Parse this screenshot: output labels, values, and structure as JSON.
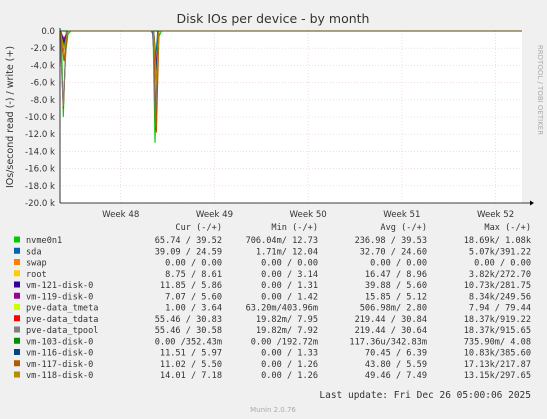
{
  "chart_data": {
    "type": "line",
    "title": "Disk IOs per device - by month",
    "ylabel": "IOs/second read (-) / write (+)",
    "xlabel": "",
    "ylim": [
      -20000,
      0
    ],
    "y_ticks": [
      "0.0",
      "-2.0 k",
      "-4.0 k",
      "-6.0 k",
      "-8.0 k",
      "-10.0 k",
      "-12.0 k",
      "-14.0 k",
      "-16.0 k",
      "-18.0 k",
      "-20.0 k"
    ],
    "y_tick_values": [
      0,
      -2000,
      -4000,
      -6000,
      -8000,
      -10000,
      -12000,
      -14000,
      -16000,
      -18000,
      -20000
    ],
    "x_ticks": [
      "Week 48",
      "Week 49",
      "Week 50",
      "Week 51",
      "Week 52"
    ],
    "x_range": [
      0,
      35
    ],
    "x_tick_values": [
      4.6,
      11.7,
      18.8,
      25.9,
      33.0
    ],
    "grid": true,
    "side_label": "RRDTOOL / TOBI OETIKER",
    "columns": [
      "Cur (-/+)",
      "Min (-/+)",
      "Avg (-/+)",
      "Max (-/+)"
    ],
    "series": [
      {
        "name": "nvme0n1",
        "color": "#00cc00",
        "cur": "65.74 / 39.52",
        "min": "706.04m/ 12.73",
        "avg": "236.98 / 39.53",
        "max": "18.69k/  1.08k",
        "x": [
          0,
          0.1,
          0.25,
          0.4,
          0.6,
          0.8,
          6.9,
          7.05,
          7.2,
          7.35,
          7.5,
          7.7,
          35
        ],
        "y": [
          0,
          -150,
          -10000,
          -2800,
          -400,
          0,
          0,
          -400,
          -13000,
          -5000,
          -600,
          0,
          0
        ]
      },
      {
        "name": "sda",
        "color": "#0066b3",
        "cur": "39.09 / 24.59",
        "min": "1.71m/ 12.04",
        "avg": "32.70 / 24.60",
        "max": "5.07k/391.22",
        "x": [
          0,
          0.25,
          0.5,
          7.0,
          7.2,
          7.4,
          35
        ],
        "y": [
          0,
          -2500,
          0,
          0,
          -4500,
          0,
          0
        ]
      },
      {
        "name": "swap",
        "color": "#ff8000",
        "cur": "0.00 /  0.00",
        "min": "0.00 /  0.00",
        "avg": "0.00 /  0.00",
        "max": "0.00 /  0.00",
        "x": [
          0,
          35
        ],
        "y": [
          0,
          0
        ]
      },
      {
        "name": "root",
        "color": "#ffcc00",
        "cur": "8.75 /  8.61",
        "min": "0.00 /  3.14",
        "avg": "16.47 /  8.96",
        "max": "3.82k/272.70",
        "x": [
          0,
          0.3,
          0.6,
          7.1,
          7.3,
          7.5,
          35
        ],
        "y": [
          0,
          -3000,
          0,
          0,
          -3800,
          0,
          0
        ]
      },
      {
        "name": "vm-121-disk-0",
        "color": "#330099",
        "cur": "11.85 /  5.86",
        "min": "0.00 /  1.31",
        "avg": "39.88 /  5.60",
        "max": "10.73k/281.75",
        "x": [
          0,
          0.3,
          0.6,
          7.1,
          7.3,
          7.5,
          35
        ],
        "y": [
          0,
          -1200,
          0,
          0,
          -5000,
          0,
          0
        ]
      },
      {
        "name": "vm-119-disk-0",
        "color": "#990099",
        "cur": "7.07 /  5.60",
        "min": "0.00 /  1.42",
        "avg": "15.85 /  5.12",
        "max": "8.34k/249.56",
        "x": [
          0,
          0.3,
          0.6,
          7.1,
          7.3,
          7.5,
          35
        ],
        "y": [
          0,
          -900,
          0,
          0,
          -4000,
          0,
          0
        ]
      },
      {
        "name": "pve-data_tmeta",
        "color": "#ccff00",
        "cur": "1.00 /  3.64",
        "min": "63.20m/403.96m",
        "avg": "506.98m/  2.80",
        "max": "7.94 / 79.44",
        "x": [
          0,
          35
        ],
        "y": [
          0,
          0
        ]
      },
      {
        "name": "pve-data_tdata",
        "color": "#ff0000",
        "cur": "55.46 / 30.83",
        "min": "19.82m/  7.95",
        "avg": "219.44 / 30.84",
        "max": "18.37k/919.22",
        "x": [
          0,
          0.25,
          0.5,
          7.05,
          7.25,
          7.45,
          35
        ],
        "y": [
          0,
          -9000,
          0,
          0,
          -11500,
          0,
          0
        ]
      },
      {
        "name": "pve-data_tpool",
        "color": "#808080",
        "cur": "55.46 / 30.58",
        "min": "19.82m/  7.92",
        "avg": "219.44 / 30.64",
        "max": "18.37k/915.65",
        "x": [
          0,
          0.25,
          0.5,
          7.05,
          7.25,
          7.45,
          35
        ],
        "y": [
          0,
          -8800,
          0,
          0,
          -11200,
          0,
          0
        ]
      },
      {
        "name": "vm-103-disk-0",
        "color": "#008f00",
        "cur": "0.00 /352.43m",
        "min": "0.00 /192.72m",
        "avg": "117.36u/342.83m",
        "max": "735.90m/  4.08",
        "x": [
          0,
          35
        ],
        "y": [
          0,
          0
        ]
      },
      {
        "name": "vm-116-disk-0",
        "color": "#00487d",
        "cur": "11.51 /  5.97",
        "min": "0.00 /  1.33",
        "avg": "70.45 /  6.39",
        "max": "10.83k/385.60",
        "x": [
          0,
          0.3,
          0.6,
          7.1,
          7.3,
          7.5,
          35
        ],
        "y": [
          0,
          -1500,
          0,
          0,
          -4800,
          0,
          0
        ]
      },
      {
        "name": "vm-117-disk-0",
        "color": "#b35a00",
        "cur": "11.02 /  5.50",
        "min": "0.00 /  1.26",
        "avg": "43.80 /  5.59",
        "max": "17.13k/217.87",
        "x": [
          0,
          0.3,
          0.6,
          7.1,
          7.3,
          7.5,
          35
        ],
        "y": [
          0,
          -3500,
          0,
          0,
          -11800,
          0,
          0
        ]
      },
      {
        "name": "vm-118-disk-0",
        "color": "#b38f00",
        "cur": "14.01 /  7.18",
        "min": "0.00 /  1.26",
        "avg": "49.46 /  7.49",
        "max": "13.15k/297.65",
        "x": [
          0,
          0.3,
          0.6,
          7.1,
          7.3,
          7.5,
          35
        ],
        "y": [
          0,
          -2000,
          0,
          0,
          -6000,
          0,
          0
        ]
      }
    ],
    "last_update": "Last update: Fri Dec 26 05:00:06 2025",
    "footer": "Munin 2.0.76"
  }
}
